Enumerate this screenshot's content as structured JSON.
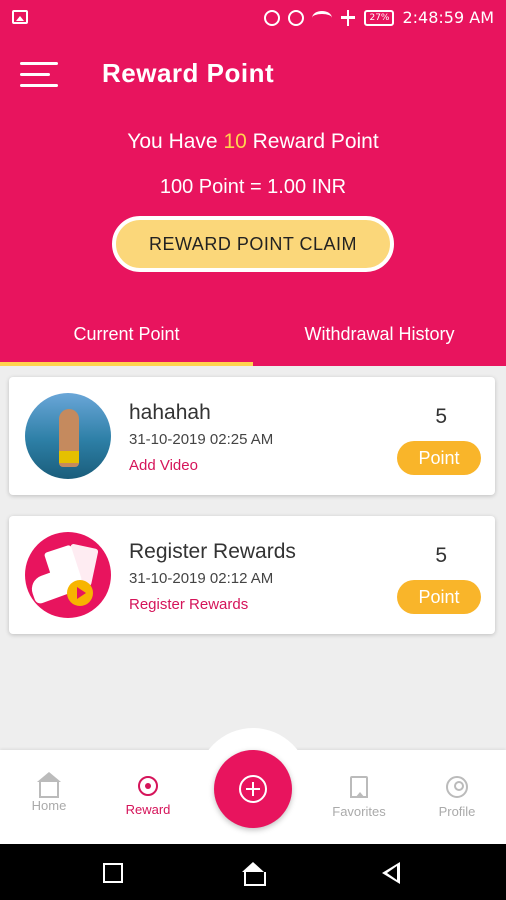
{
  "status_bar": {
    "battery": "27%",
    "time": "2:48:59 AM",
    "icons": [
      "image-icon",
      "do-not-disturb-icon",
      "alarm-icon",
      "wifi-icon",
      "airplane-icon",
      "battery-icon"
    ]
  },
  "header": {
    "title": "Reward Point",
    "balance_prefix": "You Have ",
    "balance_value": "10",
    "balance_suffix": " Reward Point",
    "conversion": "100 Point = 1.00 INR",
    "claim_button": "REWARD POINT CLAIM"
  },
  "tabs": [
    {
      "label": "Current Point",
      "active": true
    },
    {
      "label": "Withdrawal History",
      "active": false
    }
  ],
  "rewards": [
    {
      "title": "hahahah",
      "date": "31-10-2019  02:25 AM",
      "action": "Add Video",
      "points": "5",
      "badge": "Point"
    },
    {
      "title": "Register Rewards",
      "date": "31-10-2019  02:12 AM",
      "action": "Register Rewards",
      "points": "5",
      "badge": "Point"
    }
  ],
  "bottom_nav": [
    {
      "label": "Home",
      "icon": "home-icon",
      "active": false
    },
    {
      "label": "Reward",
      "icon": "reward-icon",
      "active": true
    },
    {
      "label": "",
      "icon": "add-icon",
      "active": false
    },
    {
      "label": "Favorites",
      "icon": "bookmark-icon",
      "active": false
    },
    {
      "label": "Profile",
      "icon": "profile-icon",
      "active": false
    }
  ],
  "colors": {
    "primary": "#e8145e",
    "accent_yellow": "#ffd34e",
    "claim_button": "#fbd77a",
    "point_pill": "#f9b52a"
  }
}
